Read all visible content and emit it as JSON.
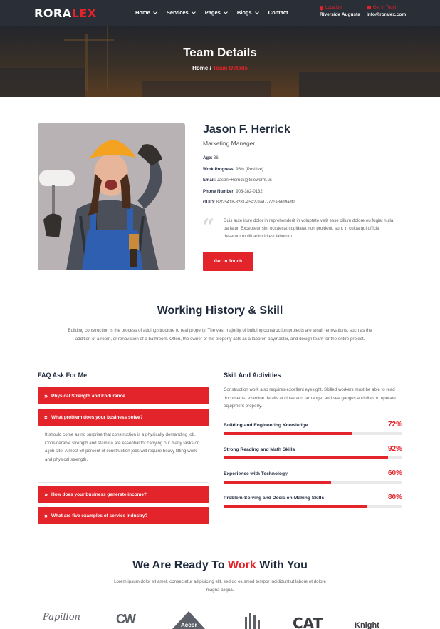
{
  "header": {
    "logo_part1": "RORA",
    "logo_part2": "LEX",
    "nav": [
      "Home",
      "Services",
      "Pages",
      "Blogs",
      "Contact"
    ],
    "location_label": "Location",
    "location_value": "Riverside Augusta",
    "contact_label": "Get In Touch",
    "contact_value": "info@roralex.com"
  },
  "banner": {
    "title": "Team Details",
    "crumb_home": "Home",
    "crumb_sep": "/",
    "crumb_current": "Team Details"
  },
  "profile": {
    "name": "Jason F. Herrick",
    "role": "Marketing Manager",
    "facts": [
      {
        "label": "Age:",
        "value": "36"
      },
      {
        "label": "Work Progress:",
        "value": "96% (Positive)"
      },
      {
        "label": "Email:",
        "value": "JasonFHerrick@teleworm.us"
      },
      {
        "label": "Phone Number:",
        "value": "903-382-0132"
      },
      {
        "label": "GUID:",
        "value": "82f25418-8281-45a2-9ad7-77ca8dd9adf2"
      }
    ],
    "quote": "Duis aute irure dolor in reprehenderit in voluptate velit esse cillum dolore eu fugiat nulla pariatur. Excepteur sint occaecat cupidatat non proident, sunt in culpa qui officia deserunt mollit anim id est laborum.",
    "button": "Get In Touch"
  },
  "history": {
    "title": "Working History & Skill",
    "text": "Building construction is the process of adding structure to real property. The vast majority of building construction projects are small renovations, such as the addition of a room, or renovation of a bathroom. Often, the owner of the property acts as a laborer, paymaster, and design team for the entire project."
  },
  "faq": {
    "heading": "FAQ Ask For Me",
    "items": [
      {
        "q": "Physical Strength and Endurance.",
        "open": false
      },
      {
        "q": "What problem does your business solve?",
        "open": true
      },
      {
        "q": "How does your business generate income?",
        "open": false
      },
      {
        "q": "What are five examples of service industry?",
        "open": false
      }
    ],
    "answer": "It should come as no surprise that construction is a physically demanding job. Considerable strength and stamina are essential for carrying out many tasks on a job site. Almost 50 percent of construction jobs will require heavy lifting work and physical strength."
  },
  "skills": {
    "heading": "Skill And Activities",
    "intro": "Construction work also requires excellent eyesight. Skilled workers must be able to read documents, examine details at close and far range, and see gauges and dials to operate equipment properly.",
    "items": [
      {
        "name": "Building and Engineering Knowledge",
        "label": "72%",
        "value": 0.72
      },
      {
        "name": "Strong Reading and Math Skills",
        "label": "92%",
        "value": 0.92
      },
      {
        "name": "Experience with Technology",
        "label": "60%",
        "value": 0.6
      },
      {
        "name": "Problem-Solving and Decision-Making Skills",
        "label": "80%",
        "value": 0.8
      }
    ]
  },
  "ready": {
    "title_pre": "We Are Ready To",
    "title_hl": "Work",
    "title_post": "With You",
    "text": "Lorem ipsum dolor sit amet, consectetur adipisicing elit, sed do eiusmod tempor incididunt ut labore et dolore magna aliqua."
  },
  "brands": [
    "Papillon",
    "CW",
    "Accor",
    "",
    "CAT",
    "Knight"
  ],
  "colors": {
    "accent": "#e3242b",
    "dark": "#1f2a3c",
    "header": "#2a2e36"
  }
}
